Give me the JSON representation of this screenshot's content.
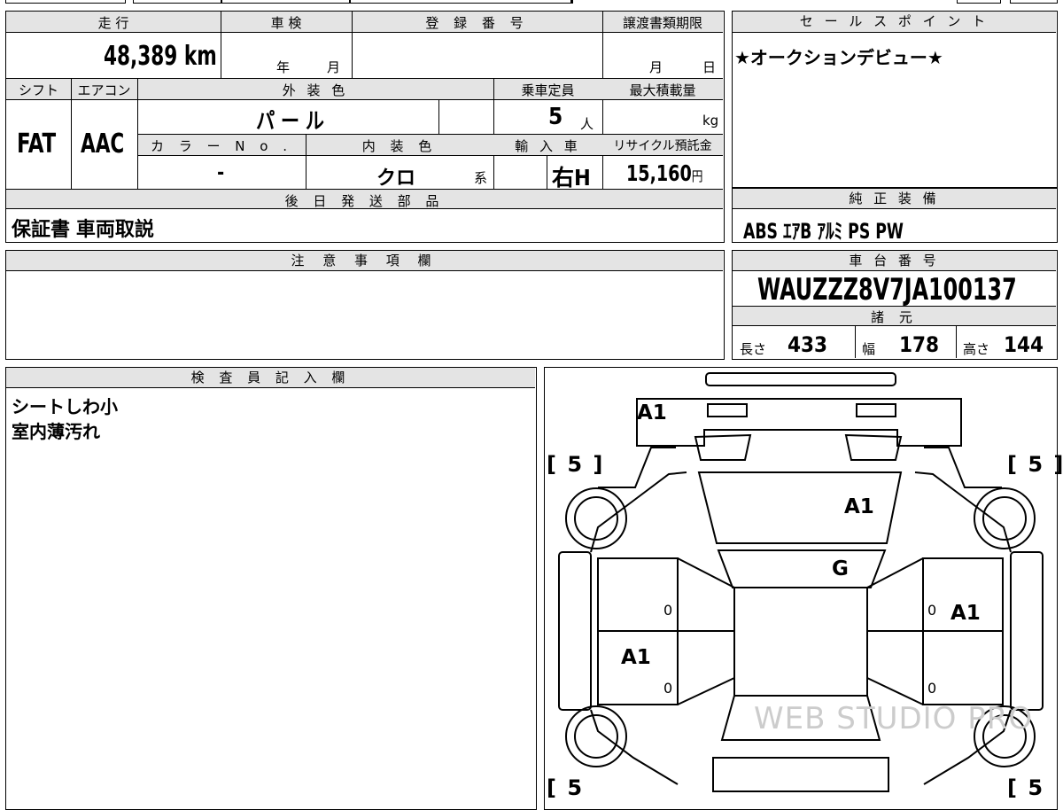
{
  "mileage": {
    "label": "走 行",
    "value": "48,389",
    "unit": "km"
  },
  "inspection": {
    "label": "車 検",
    "year": "年",
    "month": "月"
  },
  "registration": {
    "label": "登 録 番 号",
    "value": ""
  },
  "transfer": {
    "label": "譲渡書類期限",
    "month": "月",
    "day": "日"
  },
  "selling_points": {
    "label": "セ ー ル ス ポ イ ン ト",
    "text": "★オークションデビュー★"
  },
  "shift": {
    "label": "シフト",
    "value": "FAT"
  },
  "aircon": {
    "label": "エアコン",
    "value": "AAC"
  },
  "exterior": {
    "label": "外 装 色",
    "value": "パ ー ル"
  },
  "capacity": {
    "label": "乗車定員",
    "value": "5",
    "unit": "人"
  },
  "max_load": {
    "label": "最大積載量",
    "unit": "kg"
  },
  "color_no": {
    "label": "カ ラ ー  N o .",
    "value": "-"
  },
  "interior": {
    "label": "内 装 色",
    "value": "クロ",
    "suffix": "系"
  },
  "import": {
    "label": "輸 入 車",
    "value": "右H"
  },
  "recycle": {
    "label": "リサイクル預託金",
    "value": "15,160",
    "unit": "円"
  },
  "later_parts": {
    "label": "後 日 発 送 部 品",
    "value": "保証書  車両取説"
  },
  "genuine": {
    "label": "純 正 装 備",
    "value": "ABS  ｴｱB  ｱﾙﾐ  PS  PW"
  },
  "notes": {
    "label": "注 意 事 項 欄",
    "value": ""
  },
  "chassis": {
    "label": "車 台 番 号",
    "value": "WAUZZZ8V7JA100137"
  },
  "specs": {
    "label": "諸 元",
    "length_label": "長さ",
    "length": "433",
    "width_label": "幅",
    "width": "178",
    "height_label": "高さ",
    "height": "144"
  },
  "inspector": {
    "label": "検 査 員 記 入 欄",
    "line1": "シートしわ小",
    "line2": "室内薄汚れ"
  },
  "diagram": {
    "marks": [
      "A1",
      "A1",
      "G",
      "A1",
      "A1"
    ],
    "tires": [
      "[ 5 ]",
      "[ 5 ]",
      "[ 5",
      "[ 5"
    ],
    "zeros": [
      "0",
      "0",
      "0",
      "0"
    ],
    "watermark": "WEB STUDIO PRO"
  }
}
